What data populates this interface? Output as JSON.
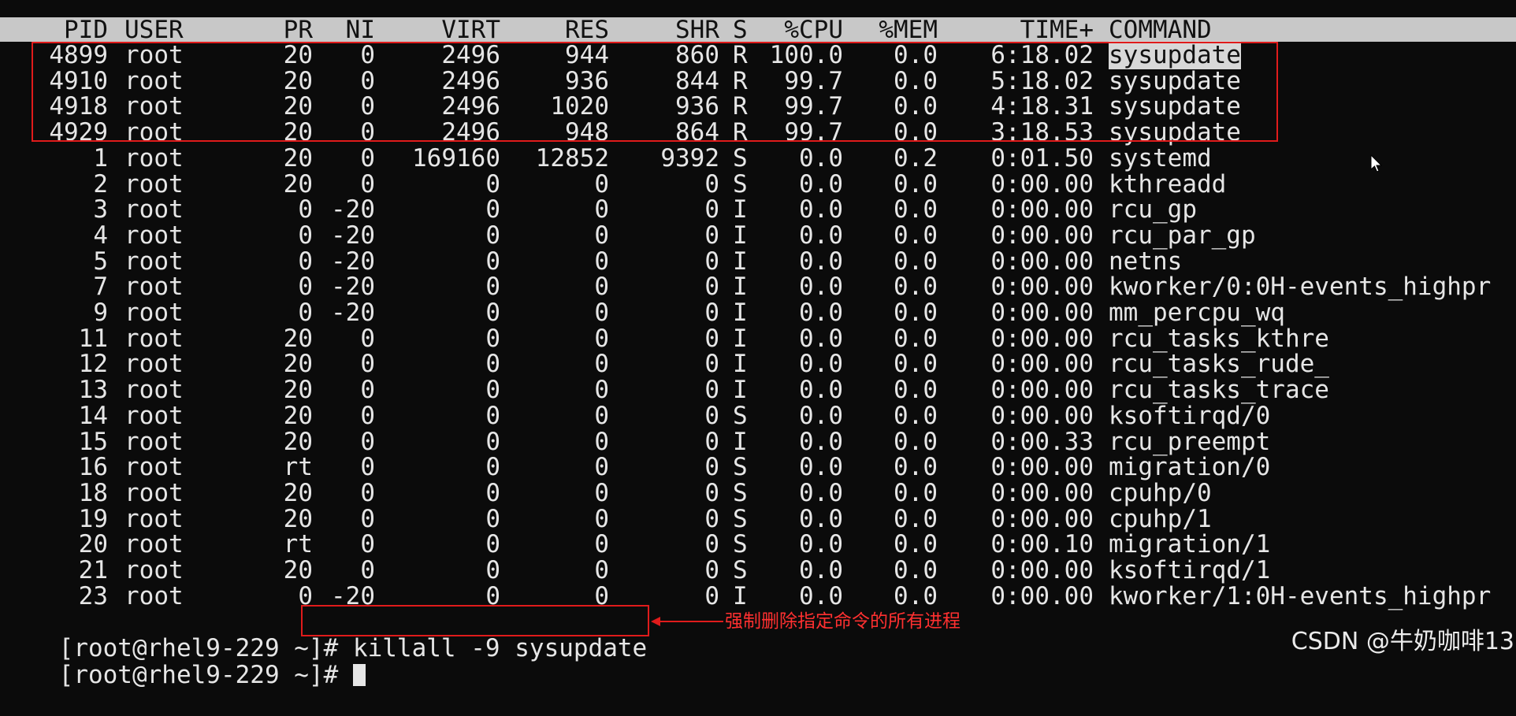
{
  "header": {
    "pid": "PID",
    "user": "USER",
    "pr": "PR",
    "ni": "NI",
    "virt": "VIRT",
    "res": "RES",
    "shr": "SHR",
    "s": "S",
    "cpu": "%CPU",
    "mem": "%MEM",
    "time": "TIME+",
    "command": "COMMAND"
  },
  "processes": [
    {
      "pid": "4899",
      "user": "root",
      "pr": "20",
      "ni": "0",
      "virt": "2496",
      "res": "944",
      "shr": "860",
      "s": "R",
      "cpu": "100.0",
      "mem": "0.0",
      "time": "6:18.02",
      "command": "sysupdate"
    },
    {
      "pid": "4910",
      "user": "root",
      "pr": "20",
      "ni": "0",
      "virt": "2496",
      "res": "936",
      "shr": "844",
      "s": "R",
      "cpu": "99.7",
      "mem": "0.0",
      "time": "5:18.02",
      "command": "sysupdate"
    },
    {
      "pid": "4918",
      "user": "root",
      "pr": "20",
      "ni": "0",
      "virt": "2496",
      "res": "1020",
      "shr": "936",
      "s": "R",
      "cpu": "99.7",
      "mem": "0.0",
      "time": "4:18.31",
      "command": "sysupdate"
    },
    {
      "pid": "4929",
      "user": "root",
      "pr": "20",
      "ni": "0",
      "virt": "2496",
      "res": "948",
      "shr": "864",
      "s": "R",
      "cpu": "99.7",
      "mem": "0.0",
      "time": "3:18.53",
      "command": "sysupdate"
    },
    {
      "pid": "1",
      "user": "root",
      "pr": "20",
      "ni": "0",
      "virt": "169160",
      "res": "12852",
      "shr": "9392",
      "s": "S",
      "cpu": "0.0",
      "mem": "0.2",
      "time": "0:01.50",
      "command": "systemd"
    },
    {
      "pid": "2",
      "user": "root",
      "pr": "20",
      "ni": "0",
      "virt": "0",
      "res": "0",
      "shr": "0",
      "s": "S",
      "cpu": "0.0",
      "mem": "0.0",
      "time": "0:00.00",
      "command": "kthreadd"
    },
    {
      "pid": "3",
      "user": "root",
      "pr": "0",
      "ni": "-20",
      "virt": "0",
      "res": "0",
      "shr": "0",
      "s": "I",
      "cpu": "0.0",
      "mem": "0.0",
      "time": "0:00.00",
      "command": "rcu_gp"
    },
    {
      "pid": "4",
      "user": "root",
      "pr": "0",
      "ni": "-20",
      "virt": "0",
      "res": "0",
      "shr": "0",
      "s": "I",
      "cpu": "0.0",
      "mem": "0.0",
      "time": "0:00.00",
      "command": "rcu_par_gp"
    },
    {
      "pid": "5",
      "user": "root",
      "pr": "0",
      "ni": "-20",
      "virt": "0",
      "res": "0",
      "shr": "0",
      "s": "I",
      "cpu": "0.0",
      "mem": "0.0",
      "time": "0:00.00",
      "command": "netns"
    },
    {
      "pid": "7",
      "user": "root",
      "pr": "0",
      "ni": "-20",
      "virt": "0",
      "res": "0",
      "shr": "0",
      "s": "I",
      "cpu": "0.0",
      "mem": "0.0",
      "time": "0:00.00",
      "command": "kworker/0:0H-events_highpr"
    },
    {
      "pid": "9",
      "user": "root",
      "pr": "0",
      "ni": "-20",
      "virt": "0",
      "res": "0",
      "shr": "0",
      "s": "I",
      "cpu": "0.0",
      "mem": "0.0",
      "time": "0:00.00",
      "command": "mm_percpu_wq"
    },
    {
      "pid": "11",
      "user": "root",
      "pr": "20",
      "ni": "0",
      "virt": "0",
      "res": "0",
      "shr": "0",
      "s": "I",
      "cpu": "0.0",
      "mem": "0.0",
      "time": "0:00.00",
      "command": "rcu_tasks_kthre"
    },
    {
      "pid": "12",
      "user": "root",
      "pr": "20",
      "ni": "0",
      "virt": "0",
      "res": "0",
      "shr": "0",
      "s": "I",
      "cpu": "0.0",
      "mem": "0.0",
      "time": "0:00.00",
      "command": "rcu_tasks_rude_"
    },
    {
      "pid": "13",
      "user": "root",
      "pr": "20",
      "ni": "0",
      "virt": "0",
      "res": "0",
      "shr": "0",
      "s": "I",
      "cpu": "0.0",
      "mem": "0.0",
      "time": "0:00.00",
      "command": "rcu_tasks_trace"
    },
    {
      "pid": "14",
      "user": "root",
      "pr": "20",
      "ni": "0",
      "virt": "0",
      "res": "0",
      "shr": "0",
      "s": "S",
      "cpu": "0.0",
      "mem": "0.0",
      "time": "0:00.00",
      "command": "ksoftirqd/0"
    },
    {
      "pid": "15",
      "user": "root",
      "pr": "20",
      "ni": "0",
      "virt": "0",
      "res": "0",
      "shr": "0",
      "s": "I",
      "cpu": "0.0",
      "mem": "0.0",
      "time": "0:00.33",
      "command": "rcu_preempt"
    },
    {
      "pid": "16",
      "user": "root",
      "pr": "rt",
      "ni": "0",
      "virt": "0",
      "res": "0",
      "shr": "0",
      "s": "S",
      "cpu": "0.0",
      "mem": "0.0",
      "time": "0:00.00",
      "command": "migration/0"
    },
    {
      "pid": "18",
      "user": "root",
      "pr": "20",
      "ni": "0",
      "virt": "0",
      "res": "0",
      "shr": "0",
      "s": "S",
      "cpu": "0.0",
      "mem": "0.0",
      "time": "0:00.00",
      "command": "cpuhp/0"
    },
    {
      "pid": "19",
      "user": "root",
      "pr": "20",
      "ni": "0",
      "virt": "0",
      "res": "0",
      "shr": "0",
      "s": "S",
      "cpu": "0.0",
      "mem": "0.0",
      "time": "0:00.00",
      "command": "cpuhp/1"
    },
    {
      "pid": "20",
      "user": "root",
      "pr": "rt",
      "ni": "0",
      "virt": "0",
      "res": "0",
      "shr": "0",
      "s": "S",
      "cpu": "0.0",
      "mem": "0.0",
      "time": "0:00.10",
      "command": "migration/1"
    },
    {
      "pid": "21",
      "user": "root",
      "pr": "20",
      "ni": "0",
      "virt": "0",
      "res": "0",
      "shr": "0",
      "s": "S",
      "cpu": "0.0",
      "mem": "0.0",
      "time": "0:00.00",
      "command": "ksoftirqd/1"
    },
    {
      "pid": "23",
      "user": "root",
      "pr": "0",
      "ni": "-20",
      "virt": "0",
      "res": "0",
      "shr": "0",
      "s": "I",
      "cpu": "0.0",
      "mem": "0.0",
      "time": "0:00.00",
      "command": "kworker/1:0H-events_highpr"
    }
  ],
  "prompt": {
    "line1_prompt": "[root@rhel9-229 ~]# ",
    "line1_command": "killall -9 sysupdate",
    "line2_prompt": "[root@rhel9-229 ~]# "
  },
  "annotation": {
    "text": "强制删除指定命令的所有进程",
    "color": "#ff3030"
  },
  "watermark": "CSDN @牛奶咖啡13",
  "colors": {
    "background": "#0b0b0b",
    "text": "#e6e6e6",
    "header_bar": "#c8c8c8",
    "highlight_box": "#e01b1b"
  },
  "icons": {
    "mouse": "mouse-pointer-icon",
    "arrow": "arrow-left-icon",
    "cursor": "text-cursor-icon"
  }
}
